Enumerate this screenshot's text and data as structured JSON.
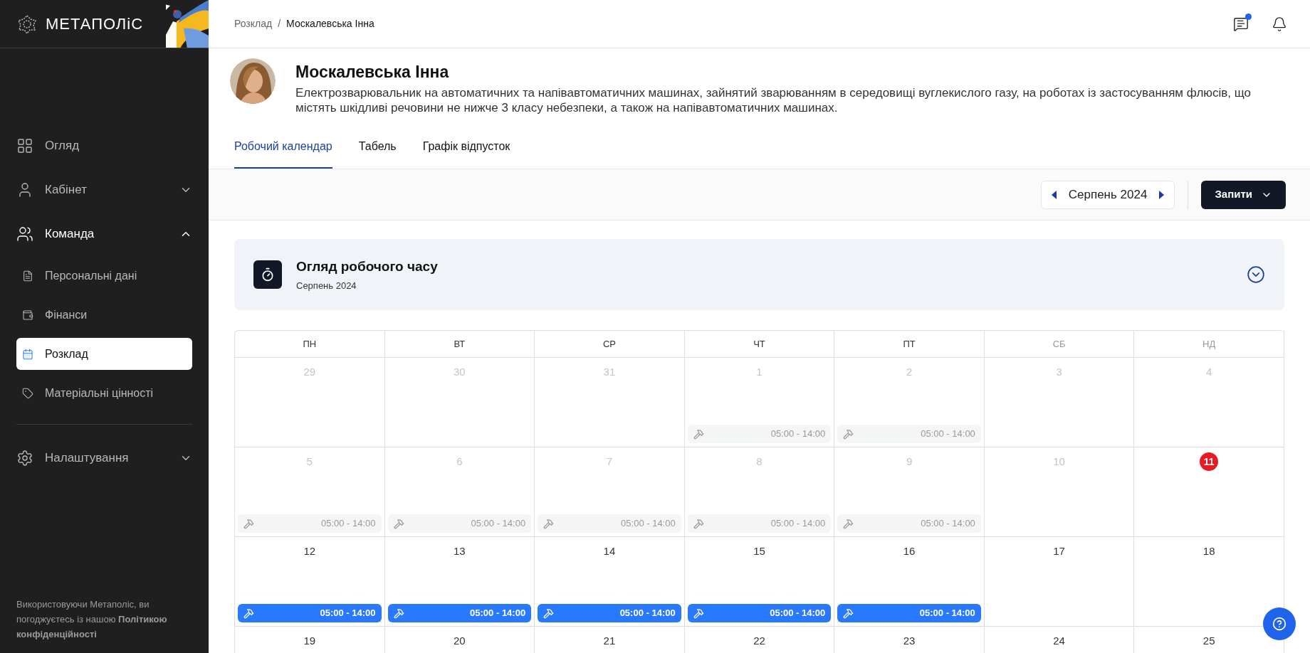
{
  "sidebar": {
    "logo": "МЕТАПОЛіС",
    "items": [
      {
        "label": "Огляд"
      },
      {
        "label": "Кабінет",
        "expanded": false
      },
      {
        "label": "Команда",
        "expanded": true,
        "children": [
          {
            "label": "Персональні дані",
            "selected": false
          },
          {
            "label": "Фінанси",
            "selected": false
          },
          {
            "label": "Розклад",
            "selected": true
          },
          {
            "label": "Матеріальні цінності",
            "selected": false
          }
        ]
      },
      {
        "label": "Налаштування",
        "expanded": false
      }
    ],
    "footer": "Використовуючи Метаполіс, ви погоджуєтесь із нашою **Політикою конфіденційності**"
  },
  "breadcrumbs": [
    "Розклад",
    "/",
    "Москалевська Інна"
  ],
  "header": {
    "messages_unread": true
  },
  "profile": {
    "name": "Москалевська Інна",
    "position": "Електрозварювальник на автоматичних та напівавтоматичних машинах, зайнятий зварюванням в середовищі вуглекислого газу, на роботах із застосуванням флюсів, що містять шкідливі речовини не нижче 3 класу небезпеки, а також на напівавтоматичних машинах."
  },
  "tabs": [
    {
      "label": "Робочий календар",
      "selected": true
    },
    {
      "label": "Табель",
      "selected": false
    },
    {
      "label": "Графік відпусток",
      "selected": false
    }
  ],
  "toolbar": {
    "month": "Серпень 2024",
    "requests": "Запити"
  },
  "overview": {
    "title": "Огляд робочого часу",
    "subtitle": "Серпень 2024",
    "expanded": false
  },
  "calendar": {
    "weekdays": [
      {
        "label": "ПН",
        "weekend": false
      },
      {
        "label": "ВТ",
        "weekend": false
      },
      {
        "label": "СР",
        "weekend": false
      },
      {
        "label": "ЧТ",
        "weekend": false
      },
      {
        "label": "ПТ",
        "weekend": false
      },
      {
        "label": "СБ",
        "weekend": true
      },
      {
        "label": "НД",
        "weekend": true
      }
    ],
    "weeks": [
      [
        {
          "day": "29",
          "kind": "muted"
        },
        {
          "day": "30",
          "kind": "muted"
        },
        {
          "day": "31",
          "kind": "muted"
        },
        {
          "day": "1",
          "kind": "muted",
          "shift": {
            "time": "05:00 - 14:00",
            "kind": "past"
          }
        },
        {
          "day": "2",
          "kind": "muted",
          "shift": {
            "time": "05:00 - 14:00",
            "kind": "past"
          }
        },
        {
          "day": "3",
          "kind": "muted"
        },
        {
          "day": "4",
          "kind": "muted"
        }
      ],
      [
        {
          "day": "5",
          "kind": "muted",
          "shift": {
            "time": "05:00 - 14:00",
            "kind": "past"
          }
        },
        {
          "day": "6",
          "kind": "muted",
          "shift": {
            "time": "05:00 - 14:00",
            "kind": "past"
          }
        },
        {
          "day": "7",
          "kind": "muted",
          "shift": {
            "time": "05:00 - 14:00",
            "kind": "past"
          }
        },
        {
          "day": "8",
          "kind": "muted",
          "shift": {
            "time": "05:00 - 14:00",
            "kind": "past"
          }
        },
        {
          "day": "9",
          "kind": "muted",
          "shift": {
            "time": "05:00 - 14:00",
            "kind": "past"
          }
        },
        {
          "day": "10",
          "kind": "muted"
        },
        {
          "day": "11",
          "kind": "today"
        }
      ],
      [
        {
          "day": "12",
          "kind": "normal",
          "shift": {
            "time": "05:00 - 14:00",
            "kind": "planned"
          }
        },
        {
          "day": "13",
          "kind": "normal",
          "shift": {
            "time": "05:00 - 14:00",
            "kind": "planned"
          }
        },
        {
          "day": "14",
          "kind": "normal",
          "shift": {
            "time": "05:00 - 14:00",
            "kind": "planned"
          }
        },
        {
          "day": "15",
          "kind": "normal",
          "shift": {
            "time": "05:00 - 14:00",
            "kind": "planned"
          }
        },
        {
          "day": "16",
          "kind": "normal",
          "shift": {
            "time": "05:00 - 14:00",
            "kind": "planned"
          }
        },
        {
          "day": "17",
          "kind": "normal"
        },
        {
          "day": "18",
          "kind": "normal"
        }
      ],
      [
        {
          "day": "19",
          "kind": "normal"
        },
        {
          "day": "20",
          "kind": "normal"
        },
        {
          "day": "21",
          "kind": "normal"
        },
        {
          "day": "22",
          "kind": "normal"
        },
        {
          "day": "23",
          "kind": "normal"
        },
        {
          "day": "24",
          "kind": "normal"
        },
        {
          "day": "25",
          "kind": "normal"
        }
      ]
    ]
  }
}
